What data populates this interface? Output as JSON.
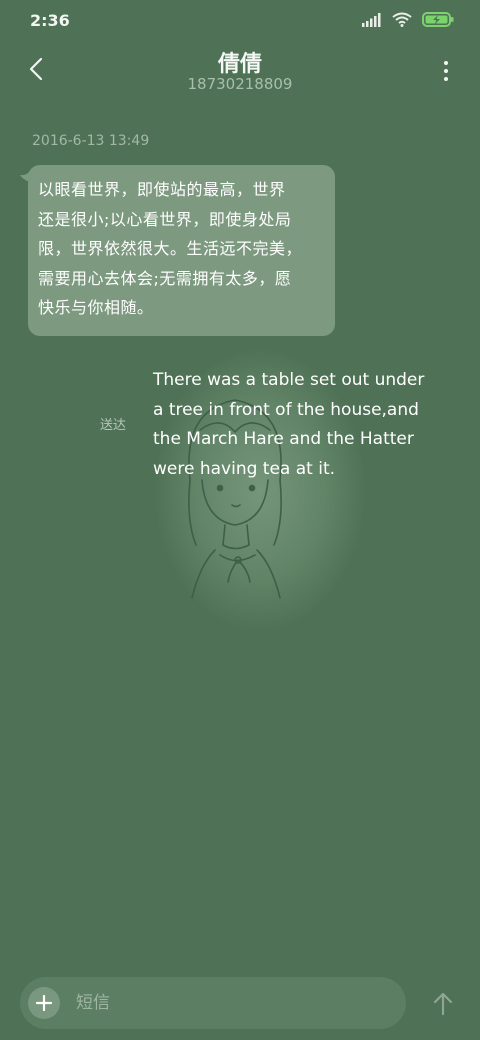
{
  "status_bar": {
    "time": "2:36",
    "icons": [
      "signal-icon",
      "wifi-icon",
      "battery-charging-icon"
    ],
    "battery_color": "#7bd36b"
  },
  "header": {
    "contact_name": "倩倩",
    "contact_number": "18730218809",
    "back_icon": "chevron-left-icon",
    "more_icon": "more-vertical-icon"
  },
  "conversation": {
    "timestamp": "2016-6-13 13:49",
    "incoming_message": "以眼看世界，即使站的最高，世界还是很小;以心看世界，即使身处局限，世界依然很大。生活远不完美，需要用心去体会;无需拥有太多，愿快乐与你相随。",
    "incoming_lines": [
      "以眼看世界，即使站的最高，世界",
      "还是很小;以心看世界，即使身处局",
      "限，世界依然很大。生活远不完美，",
      "需要用心去体会;无需拥有太多，愿",
      "快乐与你相随。"
    ],
    "outgoing_lines": [
      "There was a table set out under",
      "a tree in front of the house,and",
      "the March Hare and the Hatter",
      "were having tea at it."
    ],
    "delivery_status": "送达"
  },
  "composer": {
    "placeholder": "短信",
    "value": "",
    "add_icon": "plus-icon",
    "send_icon": "arrow-up-icon"
  },
  "colors": {
    "background": "#4f7155",
    "incoming_bubble": "#7d9a81",
    "input_bar": "#5c7e62"
  }
}
